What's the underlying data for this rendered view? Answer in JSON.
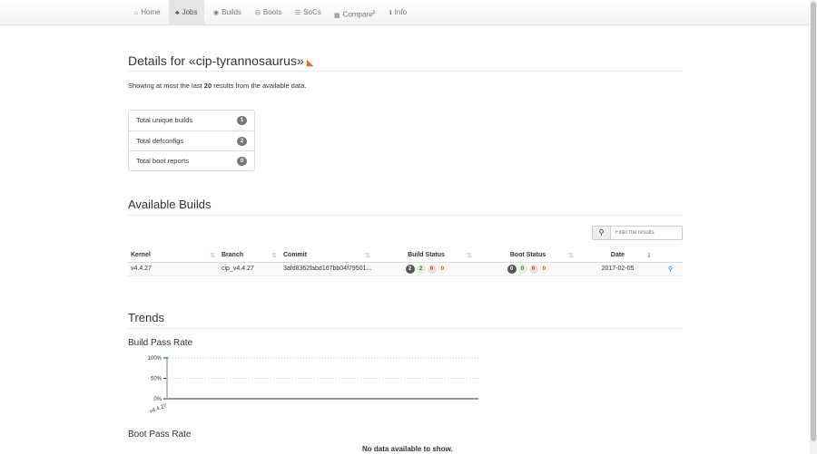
{
  "nav": [
    {
      "label": "Home",
      "icon": "home-icon",
      "glyph": "⌂"
    },
    {
      "label": "Jobs",
      "icon": "sitemap-icon",
      "glyph": "♣"
    },
    {
      "label": "Builds",
      "icon": "cube-icon",
      "glyph": "◉"
    },
    {
      "label": "Boots",
      "icon": "hdd-icon",
      "glyph": "⊟"
    },
    {
      "label": "SoCs",
      "icon": "th-list-icon",
      "glyph": "☰"
    },
    {
      "label": "Compare",
      "icon": "th-large-icon",
      "glyph": "▦",
      "sup": "β"
    },
    {
      "label": "Info",
      "icon": "info-icon",
      "glyph": "ℹ"
    }
  ],
  "active_nav": "Jobs",
  "header": {
    "title": "Details for «cip-tyrannosaurus»",
    "rss_icon": "rss-icon"
  },
  "lead": {
    "pre": "Showing at most the last ",
    "count": "20",
    "post": " results from the available data."
  },
  "summary": [
    {
      "label": "Total unique builds",
      "count": "1"
    },
    {
      "label": "Total defconfigs",
      "count": "2"
    },
    {
      "label": "Total boot reports",
      "count": "0"
    }
  ],
  "builds": {
    "title": "Available Builds",
    "search_placeholder": "Filter the results",
    "columns": [
      "Kernel",
      "Branch",
      "Commit",
      "Build Status",
      "Boot Status",
      "Date"
    ],
    "rows": [
      {
        "kernel": "v4.4.27",
        "branch": "cip_v4.4.27",
        "commit": "3afd8362fabd167bb04f79501...",
        "build_status": [
          "2",
          "2",
          "0",
          "0"
        ],
        "boot_status": [
          "0",
          "0",
          "0",
          "0"
        ],
        "date": "2017-02-05"
      }
    ]
  },
  "trends": {
    "title": "Trends",
    "build_title": "Build Pass Rate",
    "boot_title": "Boot Pass Rate",
    "boot_nodata": "No data available to show."
  },
  "chart_data": {
    "type": "line",
    "title": "Build Pass Rate",
    "categories": [
      "v4.4.27"
    ],
    "values": [
      100
    ],
    "yticks": [
      "0%",
      "50%",
      "100%"
    ],
    "ylim": [
      0,
      100
    ],
    "grid": true,
    "color": "#5cb85c"
  }
}
